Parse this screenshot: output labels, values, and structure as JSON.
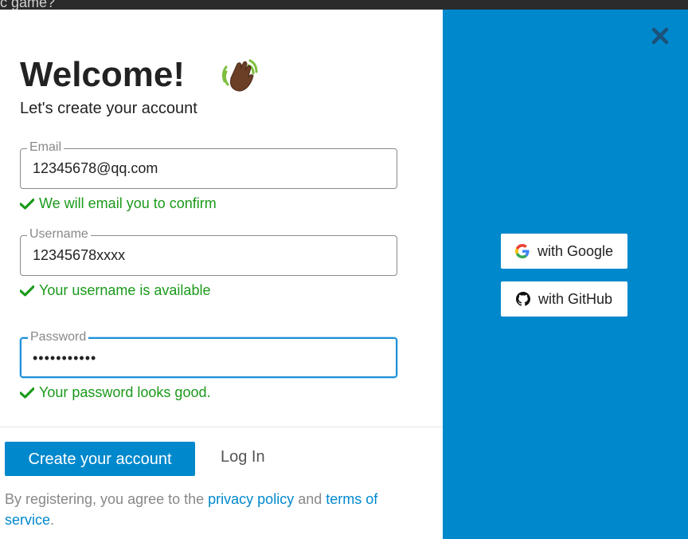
{
  "background": {
    "peek_text": "c game?"
  },
  "header": {
    "title": "Welcome!",
    "subtitle": "Let's create your account"
  },
  "form": {
    "email": {
      "label": "Email",
      "value": "12345678@qq.com",
      "hint": "We will email you to confirm"
    },
    "username": {
      "label": "Username",
      "value": "12345678xxxx",
      "hint": "Your username is available"
    },
    "password": {
      "label": "Password",
      "value": "•••••••••••",
      "hint": "Your password looks good."
    }
  },
  "actions": {
    "create_label": "Create your account",
    "login_label": "Log In"
  },
  "legal": {
    "prefix": "By registering, you agree to the ",
    "privacy_label": "privacy policy",
    "and": " and ",
    "terms_label": "terms of service",
    "suffix": "."
  },
  "oauth": {
    "google_label": "with Google",
    "github_label": "with GitHub"
  },
  "colors": {
    "accent": "#0088cc",
    "success": "#1a9a1a",
    "focus": "#1d8fd6"
  },
  "icons": {
    "wave": "waving-hand-icon",
    "close": "close-icon",
    "check": "check-icon",
    "google": "google-icon",
    "github": "github-icon"
  }
}
